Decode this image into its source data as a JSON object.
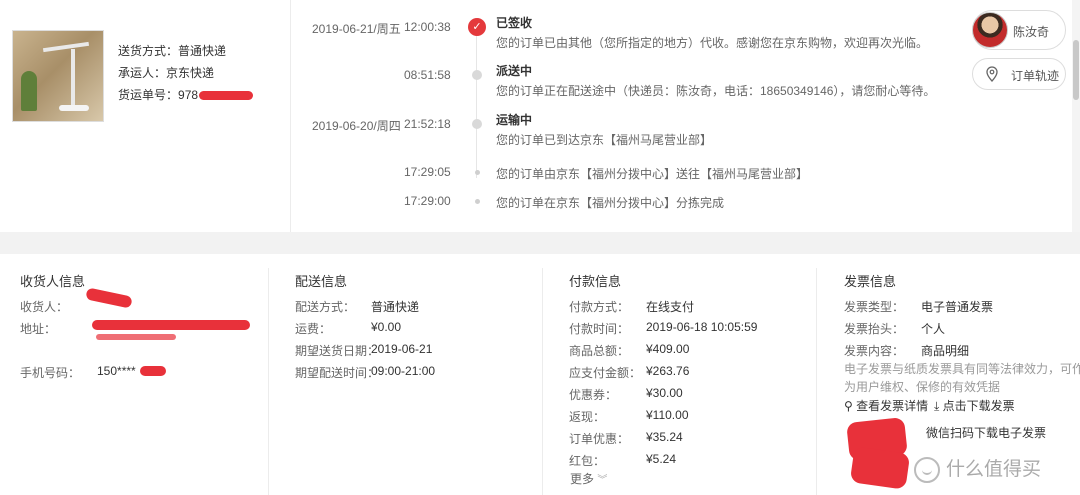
{
  "shipment": {
    "method_label": "送货方式：",
    "method_value": "普通快递",
    "carrier_label": "承运人：",
    "carrier_value": "京东快递",
    "tracking_label": "货运单号：",
    "tracking_value_visible": "978"
  },
  "timeline": [
    {
      "date": "2019-06-21/周五",
      "time": "12:00:38",
      "status": "已签收",
      "text": "您的订单已由其他（您所指定的地方）代收。感谢您在京东购物，欢迎再次光临。"
    },
    {
      "date": "",
      "time": "08:51:58",
      "status": "派送中",
      "text": "您的订单正在配送途中（快递员：陈汝奇，电话：18650349146），请您耐心等待。"
    },
    {
      "date": "2019-06-20/周四",
      "time": "21:52:18",
      "status": "运输中",
      "text": "您的订单已到达京东【福州马尾营业部】"
    },
    {
      "date": "",
      "time": "17:29:05",
      "status": "",
      "text": "您的订单由京东【福州分拨中心】送往【福州马尾营业部】"
    },
    {
      "date": "",
      "time": "17:29:00",
      "status": "",
      "text": "您的订单在京东【福州分拨中心】分拣完成"
    }
  ],
  "courier": {
    "name": "陈汝奇",
    "track_label": "订单轨迹"
  },
  "recipient": {
    "title": "收货人信息",
    "name_label": "收货人：",
    "address_label": "地址：",
    "phone_label": "手机号码：",
    "phone_value_visible": "150****"
  },
  "delivery": {
    "title": "配送信息",
    "rows": [
      {
        "k": "配送方式：",
        "v": "普通快递"
      },
      {
        "k": "运费：",
        "v": "¥0.00"
      },
      {
        "k": "期望送货日期：",
        "v": "2019-06-21"
      },
      {
        "k": "期望配送时间：",
        "v": "09:00-21:00"
      }
    ]
  },
  "payment": {
    "title": "付款信息",
    "rows": [
      {
        "k": "付款方式：",
        "v": "在线支付"
      },
      {
        "k": "付款时间：",
        "v": "2019-06-18 10:05:59"
      },
      {
        "k": "商品总额：",
        "v": "¥409.00"
      },
      {
        "k": "应支付金额：",
        "v": "¥263.76"
      },
      {
        "k": "优惠券：",
        "v": "¥30.00"
      },
      {
        "k": "返现：",
        "v": "¥110.00"
      },
      {
        "k": "订单优惠：",
        "v": "¥35.24"
      },
      {
        "k": "红包：",
        "v": "¥5.24"
      }
    ],
    "more_label": "更多"
  },
  "invoice": {
    "title": "发票信息",
    "rows": [
      {
        "k": "发票类型：",
        "v": "电子普通发票"
      },
      {
        "k": "发票抬头：",
        "v": "个人"
      },
      {
        "k": "发票内容：",
        "v": "商品明细"
      }
    ],
    "note": "电子发票与纸质发票具有同等法律效力，可作为用户维权、保修的有效凭据",
    "view_label": "查看发票详情",
    "download_label": "点击下载发票",
    "wechat_label": "微信扫码下载电子发票"
  },
  "watermark": "什么值得买",
  "colors": {
    "accent": "#e4393c",
    "redaction": "#e8313a"
  }
}
